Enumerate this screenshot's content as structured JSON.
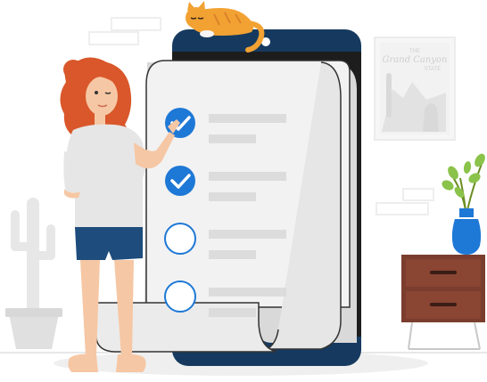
{
  "poster": {
    "line1": "THE",
    "line2": "Grand Canyon",
    "line3": "STATE"
  },
  "checklist": {
    "items": [
      {
        "checked": true
      },
      {
        "checked": true
      },
      {
        "checked": false
      },
      {
        "checked": false
      }
    ]
  },
  "colors": {
    "phone_navy": "#163a5f",
    "check_blue": "#1e78d6",
    "hair": "#d9572a",
    "shorts": "#1d4c7d",
    "shirt": "#e6e6e6",
    "cat": "#f2a233",
    "vase": "#1e78d6",
    "drawer": "#7a3d2e",
    "leaves": "#8bc34a"
  }
}
